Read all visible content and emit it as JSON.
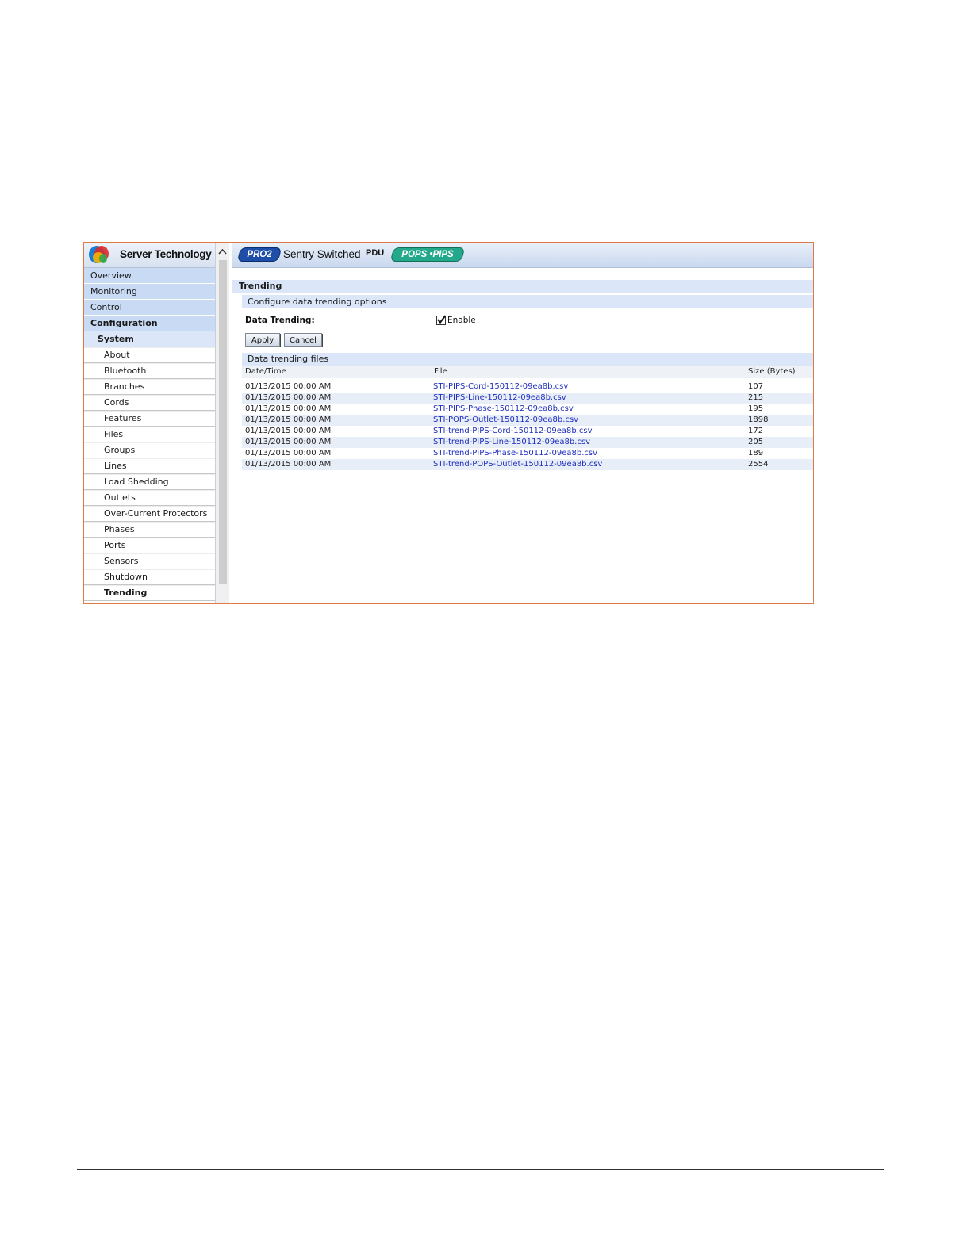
{
  "sidebar": {
    "brand": "Server Technology",
    "top_items": [
      "Overview",
      "Monitoring",
      "Control",
      "Configuration"
    ],
    "system_label": "System",
    "sub_items": [
      "About",
      "Bluetooth",
      "Branches",
      "Cords",
      "Features",
      "Files",
      "Groups",
      "Lines",
      "Load Shedding",
      "Outlets",
      "Over-Current Protectors",
      "Phases",
      "Ports",
      "Sensors",
      "Shutdown",
      "Trending"
    ],
    "active_top": "Configuration",
    "active_sub": "Trending"
  },
  "banner": {
    "pro2_label": "PRO2",
    "product_title": "Sentry Switched",
    "product_suffix": "PDU",
    "pops_label": "POPS •PIPS"
  },
  "page": {
    "title": "Trending",
    "config_section": "Configure data trending options",
    "data_trending_label": "Data Trending:",
    "enable_label": "Enable",
    "enable_checked": true,
    "apply_label": "Apply",
    "cancel_label": "Cancel",
    "files_section": "Data trending files"
  },
  "table": {
    "headers": {
      "date": "Date/Time",
      "file": "File",
      "size": "Size (Bytes)"
    },
    "rows": [
      {
        "date": "01/13/2015  00:00 AM",
        "file": "STI-PIPS-Cord-150112-09ea8b.csv",
        "size": "107"
      },
      {
        "date": "01/13/2015  00:00 AM",
        "file": "STI-PIPS-Line-150112-09ea8b.csv",
        "size": "215"
      },
      {
        "date": "01/13/2015  00:00 AM",
        "file": "STI-PIPS-Phase-150112-09ea8b.csv",
        "size": "195"
      },
      {
        "date": "01/13/2015  00:00 AM",
        "file": "STI-POPS-Outlet-150112-09ea8b.csv",
        "size": "1898"
      },
      {
        "date": "01/13/2015  00:00 AM",
        "file": "STI-trend-PIPS-Cord-150112-09ea8b.csv",
        "size": "172"
      },
      {
        "date": "01/13/2015  00:00 AM",
        "file": "STI-trend-PIPS-Line-150112-09ea8b.csv",
        "size": "205"
      },
      {
        "date": "01/13/2015  00:00 AM",
        "file": "STI-trend-PIPS-Phase-150112-09ea8b.csv",
        "size": "189"
      },
      {
        "date": "01/13/2015  00:00 AM",
        "file": "STI-trend-POPS-Outlet-150112-09ea8b.csv",
        "size": "2554"
      }
    ]
  },
  "colors": {
    "frame_border": "#e07a45",
    "nav_blue": "#c9daf4",
    "section_blue": "#dbe7f8",
    "link": "#1f2fbf",
    "pro2_badge": "#1e4ea8",
    "pops_badge": "#23a88b"
  },
  "icons": {
    "logo": "server-technology-logo-icon",
    "scroll_up": "chevron-up-icon",
    "checkbox": "checkmark-icon"
  }
}
